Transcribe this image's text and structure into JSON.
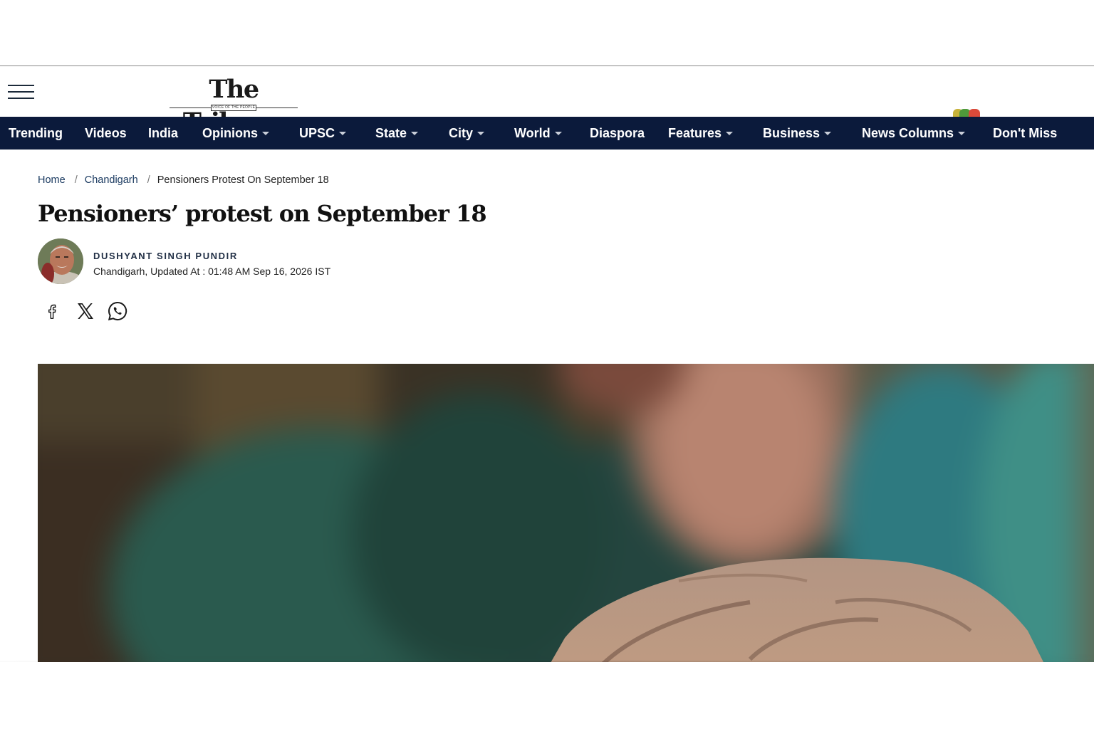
{
  "header": {
    "menu_icon": "hamburger-menu-icon",
    "logo_text": "The Tribune",
    "logo_tagline": "VOICE OF THE PEOPLE"
  },
  "nav": {
    "items": [
      {
        "label": "Trending",
        "has_dropdown": false
      },
      {
        "label": "Videos",
        "has_dropdown": false
      },
      {
        "label": "India",
        "has_dropdown": false
      },
      {
        "label": "Opinions",
        "has_dropdown": true
      },
      {
        "label": "UPSC",
        "has_dropdown": true
      },
      {
        "label": "State",
        "has_dropdown": true
      },
      {
        "label": "City",
        "has_dropdown": true
      },
      {
        "label": "World",
        "has_dropdown": true
      },
      {
        "label": "Diaspora",
        "has_dropdown": false
      },
      {
        "label": "Features",
        "has_dropdown": true
      },
      {
        "label": "Business",
        "has_dropdown": true
      },
      {
        "label": "News Columns",
        "has_dropdown": true
      },
      {
        "label": "Don't Miss",
        "has_dropdown": false
      }
    ]
  },
  "breadcrumb": {
    "home": "Home",
    "section": "Chandigarh",
    "current": "Pensioners Protest On September 18",
    "separator": "/"
  },
  "article": {
    "title": "Pensioners’ protest on September 18",
    "author": "Dushyant Singh Pundir",
    "dateline": "Chandigarh, Updated At : 01:48 AM Sep 16, 2026 IST"
  },
  "share": {
    "icons": [
      "facebook-icon",
      "x-icon",
      "whatsapp-icon"
    ]
  },
  "colors": {
    "nav_background": "#0b1a3b",
    "nav_text": "#ffffff",
    "link": "#17375e",
    "title": "#111111"
  }
}
